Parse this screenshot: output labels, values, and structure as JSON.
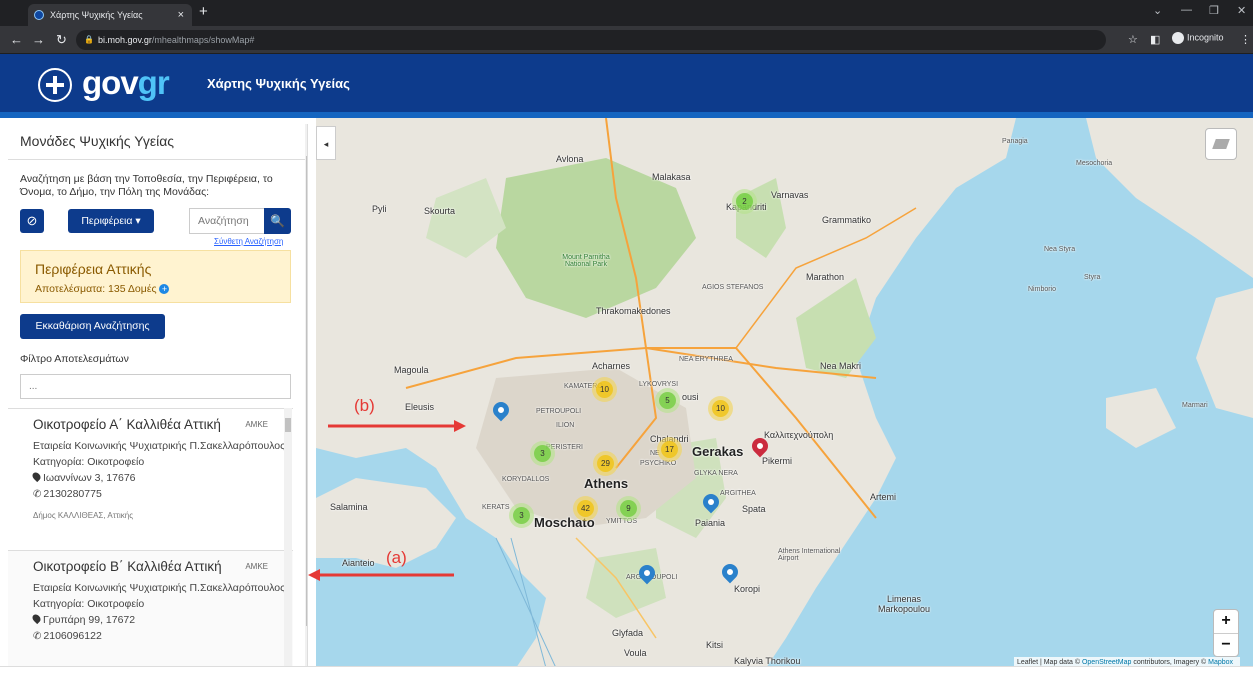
{
  "browser": {
    "tab_title": "Χάρτης Ψυχικής Υγείας",
    "tab_close": "×",
    "new_tab": "+",
    "url_domain": "bi.moh.gov.gr",
    "url_path": "/mhealthmaps/showMap#",
    "incognito_label": "Incognito"
  },
  "header": {
    "logo_text_gov": "gov",
    "logo_text_gr": "gr",
    "site_title": "Χάρτης Ψυχικής Υγείας"
  },
  "sidebar": {
    "title": "Μονάδες Ψυχικής Υγείας",
    "search_hint": "Αναζήτηση με βάση την Τοποθεσία, την Περιφέρεια, το Όνομα, το Δήμο, την Πόλη της Μονάδας:",
    "clear_icon_glyph": "⊘",
    "region_button": "Περιφέρεια ▾",
    "search_placeholder": "Αναζήτηση",
    "search_icon_glyph": "🔍",
    "advanced_search": "Σύνθετη Αναζήτηση",
    "region_title": "Περιφέρεια Αττικής",
    "region_count": "Αποτελέσματα: 135 Δομές",
    "reset_button": "Εκκαθάριση Αναζήτησης",
    "filter_label": "Φίλτρο Αποτελεσμάτων",
    "filter_placeholder": "...",
    "results": [
      {
        "name": "Οικοτροφείο Α΄ Καλλιθέα Αττική",
        "type": "ΑΜΚΕ",
        "org": "Εταιρεία Κοινωνικής Ψυχιατρικής Π.Σακελλαρόπουλος",
        "category": "Κατηγορία: Οικοτροφείο",
        "address": "Ιωαννίνων 3, 17676",
        "phone": "2130280775",
        "municipality": "Δήμος ΚΑΛΛΙΘΕΑΣ, Αττικής"
      },
      {
        "name": "Οικοτροφείο Β΄ Καλλιθέα Αττική",
        "type": "ΑΜΚΕ",
        "org": "Εταιρεία Κοινωνικής Ψυχιατρικής Π.Σακελλαρόπουλος",
        "category": "Κατηγορία: Οικοτροφείο",
        "address": "Γρυπάρη 99, 17672",
        "phone": "2106096122",
        "municipality": ""
      }
    ]
  },
  "map": {
    "collapse_glyph": "◂",
    "zoom_in": "+",
    "zoom_out": "−",
    "attribution_prefix": "Leaflet | Map data © ",
    "attribution_osm": "OpenStreetMap",
    "attribution_mid": " contributors, Imagery © ",
    "attribution_mapbox": "Mapbox",
    "labels": {
      "athens": "Athens",
      "gerakas": "Gerakas",
      "moschato": "Moschato",
      "acharnes": "Acharnes",
      "magoula": "Magoula",
      "eleusis": "Eleusis",
      "salamina": "Salamina",
      "aianteio": "Aianteio",
      "glyfada": "Glyfada",
      "voula": "Voula",
      "kitsi": "Kitsi",
      "paiania": "Paiania",
      "spata": "Spata",
      "artemi": "Artemi",
      "pikermi": "Pikermi",
      "koropi": "Koropi",
      "kalyvia": "Kalyvia Thorikou",
      "marathon": "Marathon",
      "nea_makri": "Nea Makri",
      "varnavas": "Varnavas",
      "grammatiko": "Grammatiko",
      "thrakomakedones": "Thrakomakedones",
      "malakasa": "Malakasa",
      "avlona": "Avlona",
      "pyli": "Pyli",
      "skourta": "Skourta",
      "marmari": "Marmari",
      "styra": "Styra",
      "nea_styra": "Nea Styra",
      "nimborio": "Nimborio",
      "panagia": "Panagia",
      "mesochoria": "Mesochoria",
      "limenas": "Limenas Markopoulou",
      "kallitechnoupoli": "Καλλιτεχνούπολη",
      "mount_parnitha": "Mount Parnitha National Park",
      "airport": "Athens International Airport",
      "kamatero": "KAMATERO",
      "nea_erythrea": "NEA ERYTHREA",
      "korydallos": "KORYDALLOS",
      "peristeri": "PERISTERI",
      "ilion": "ILION",
      "petroupoli": "PETROUPOLI",
      "chalandri": "Chalandri",
      "ymittos": "YMITTOS",
      "argyroupoli": "ARGYROUPOLI",
      "agios_stefanos": "AGIOS STEFANOS",
      "likovrysi": "LYKOVRYSI",
      "glyka_nera": "GLYKA NERA",
      "kerat": "KERATS",
      "psychiko": "PSYCHIKO",
      "kapandriti": "Kapandriti",
      "ousi": "ousi",
      "agia_paraskevi_ne": "NE",
      "argithea": "ARGITHEA"
    },
    "clusters": [
      {
        "count": "2"
      },
      {
        "count": "10"
      },
      {
        "count": "5"
      },
      {
        "count": "10"
      },
      {
        "count": "17"
      },
      {
        "count": "3"
      },
      {
        "count": "29"
      },
      {
        "count": "42"
      },
      {
        "count": "9"
      },
      {
        "count": "3"
      }
    ],
    "annotation_a": "(a)",
    "annotation_b": "(b)"
  }
}
